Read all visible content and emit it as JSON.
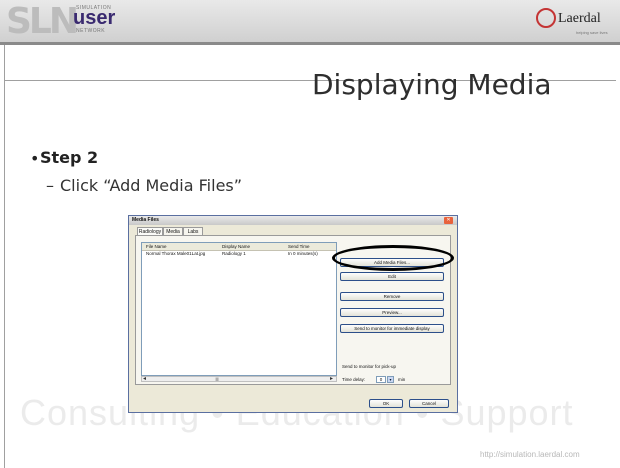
{
  "header": {
    "logo": {
      "mark": "SLN",
      "product": "user",
      "line_top": "SIMULATION",
      "line_bottom": "NETWORK"
    },
    "brand": {
      "name": "Laerdal",
      "tagline": "helping save lives"
    }
  },
  "slide": {
    "title": "Displaying Media",
    "bullet": "Step 2",
    "sub_bullet": "Click “Add Media Files”",
    "watermark": "Consulting  •  Education  •  Support",
    "url": "http://simulation.laerdal.com"
  },
  "dialog": {
    "title": "Media Files",
    "close_glyph": "✕",
    "tabs": [
      "Radiology",
      "Media",
      "Labs"
    ],
    "active_tab": 0,
    "columns": [
      "File Name",
      "Display Name",
      "Send Time"
    ],
    "rows": [
      [
        "Normal Thorax Male01Lat.jpg",
        "Radiology 1",
        "In 0 minutes(s)"
      ]
    ],
    "buttons": {
      "add": "Add Media Files...",
      "edit": "Edit",
      "remove": "Remove",
      "preview": "Preview...",
      "send_now": "Send to monitor for immediate display",
      "ok": "OK",
      "cancel": "Cancel"
    },
    "send_pickup_label": "Send to monitor for pick-up",
    "time_delay_label": "Time delay:",
    "time_delay_value": "0",
    "time_unit": "min",
    "scroll_left": "◂",
    "scroll_right": "▸",
    "scroll_thumb": "|||",
    "dropdown_glyph": "▾"
  },
  "colors": {
    "highlight": "#000000",
    "brand_red": "#c43434",
    "logo_purple": "#3a2a70"
  }
}
